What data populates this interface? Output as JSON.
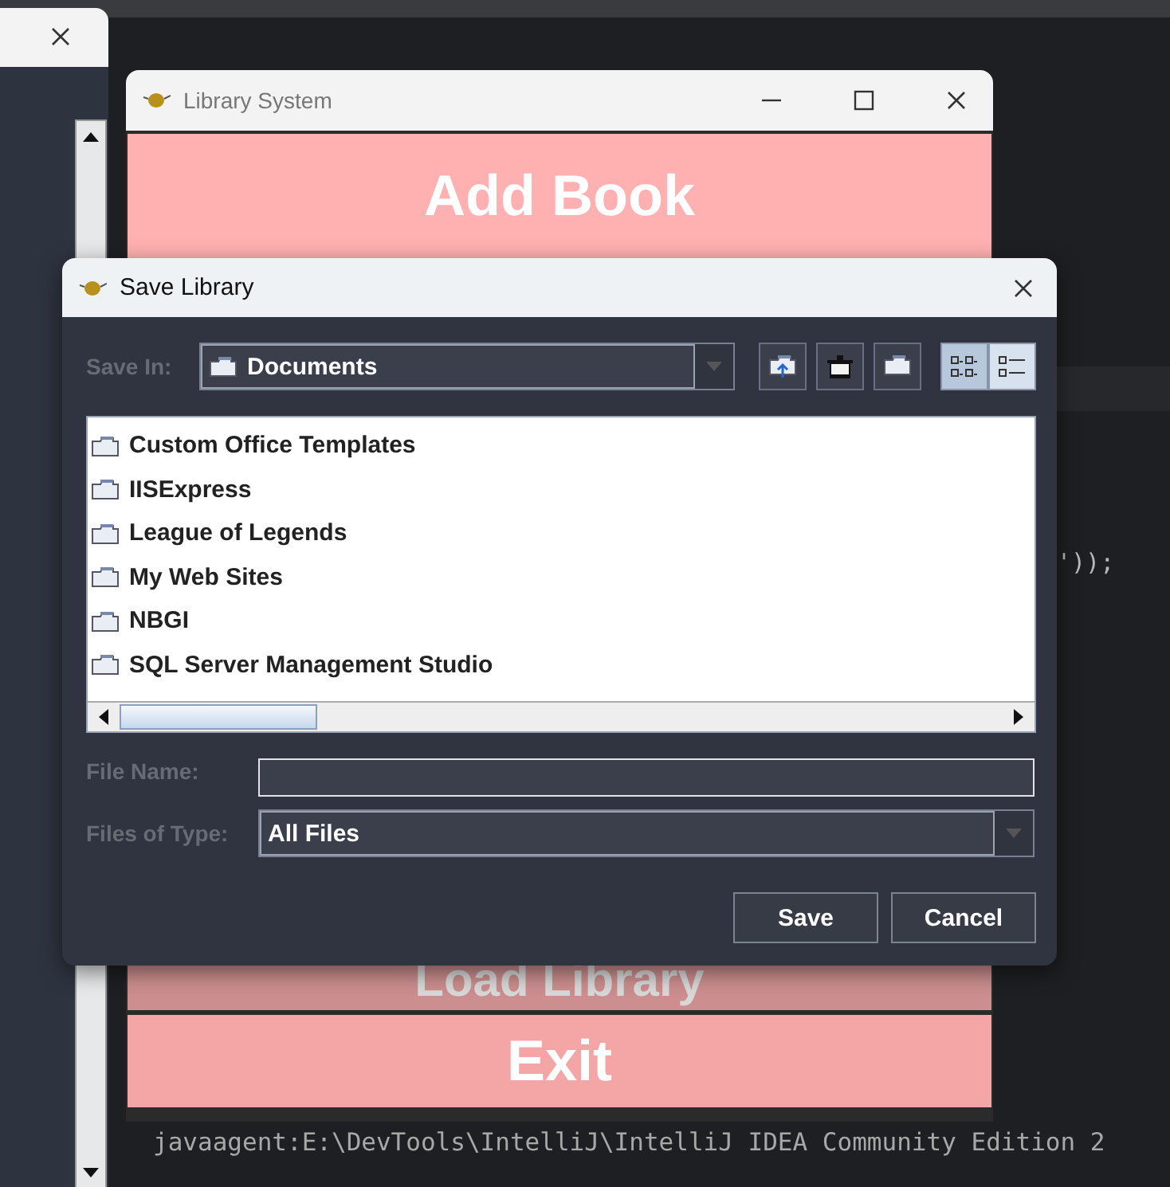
{
  "editor": {
    "code_fragment": "'));",
    "console_line": "javaagent:E:\\DevTools\\IntelliJ\\IntelliJ IDEA Community Edition 2"
  },
  "main_window": {
    "title": "Library System",
    "buttons": [
      {
        "label": "Add Book",
        "covered": false
      },
      {
        "label": "Load Library",
        "covered": true
      },
      {
        "label": "Exit",
        "covered": false
      }
    ]
  },
  "dialog": {
    "title": "Save Library",
    "save_in": {
      "label": "Save In:",
      "value": "Documents"
    },
    "view_modes": [
      {
        "kind": "icons",
        "selected": true
      },
      {
        "kind": "details",
        "selected": false
      }
    ],
    "files": [
      {
        "name": "Custom Office Templates"
      },
      {
        "name": "IISExpress"
      },
      {
        "name": "League of Legends"
      },
      {
        "name": "My Web Sites"
      },
      {
        "name": "NBGI"
      },
      {
        "name": "SQL Server Management Studio"
      }
    ],
    "file_name": {
      "label": "File Name:"
    },
    "file_type": {
      "label": "Files of Type:",
      "value": "All Files"
    },
    "buttons": [
      "Save",
      "Cancel"
    ]
  }
}
